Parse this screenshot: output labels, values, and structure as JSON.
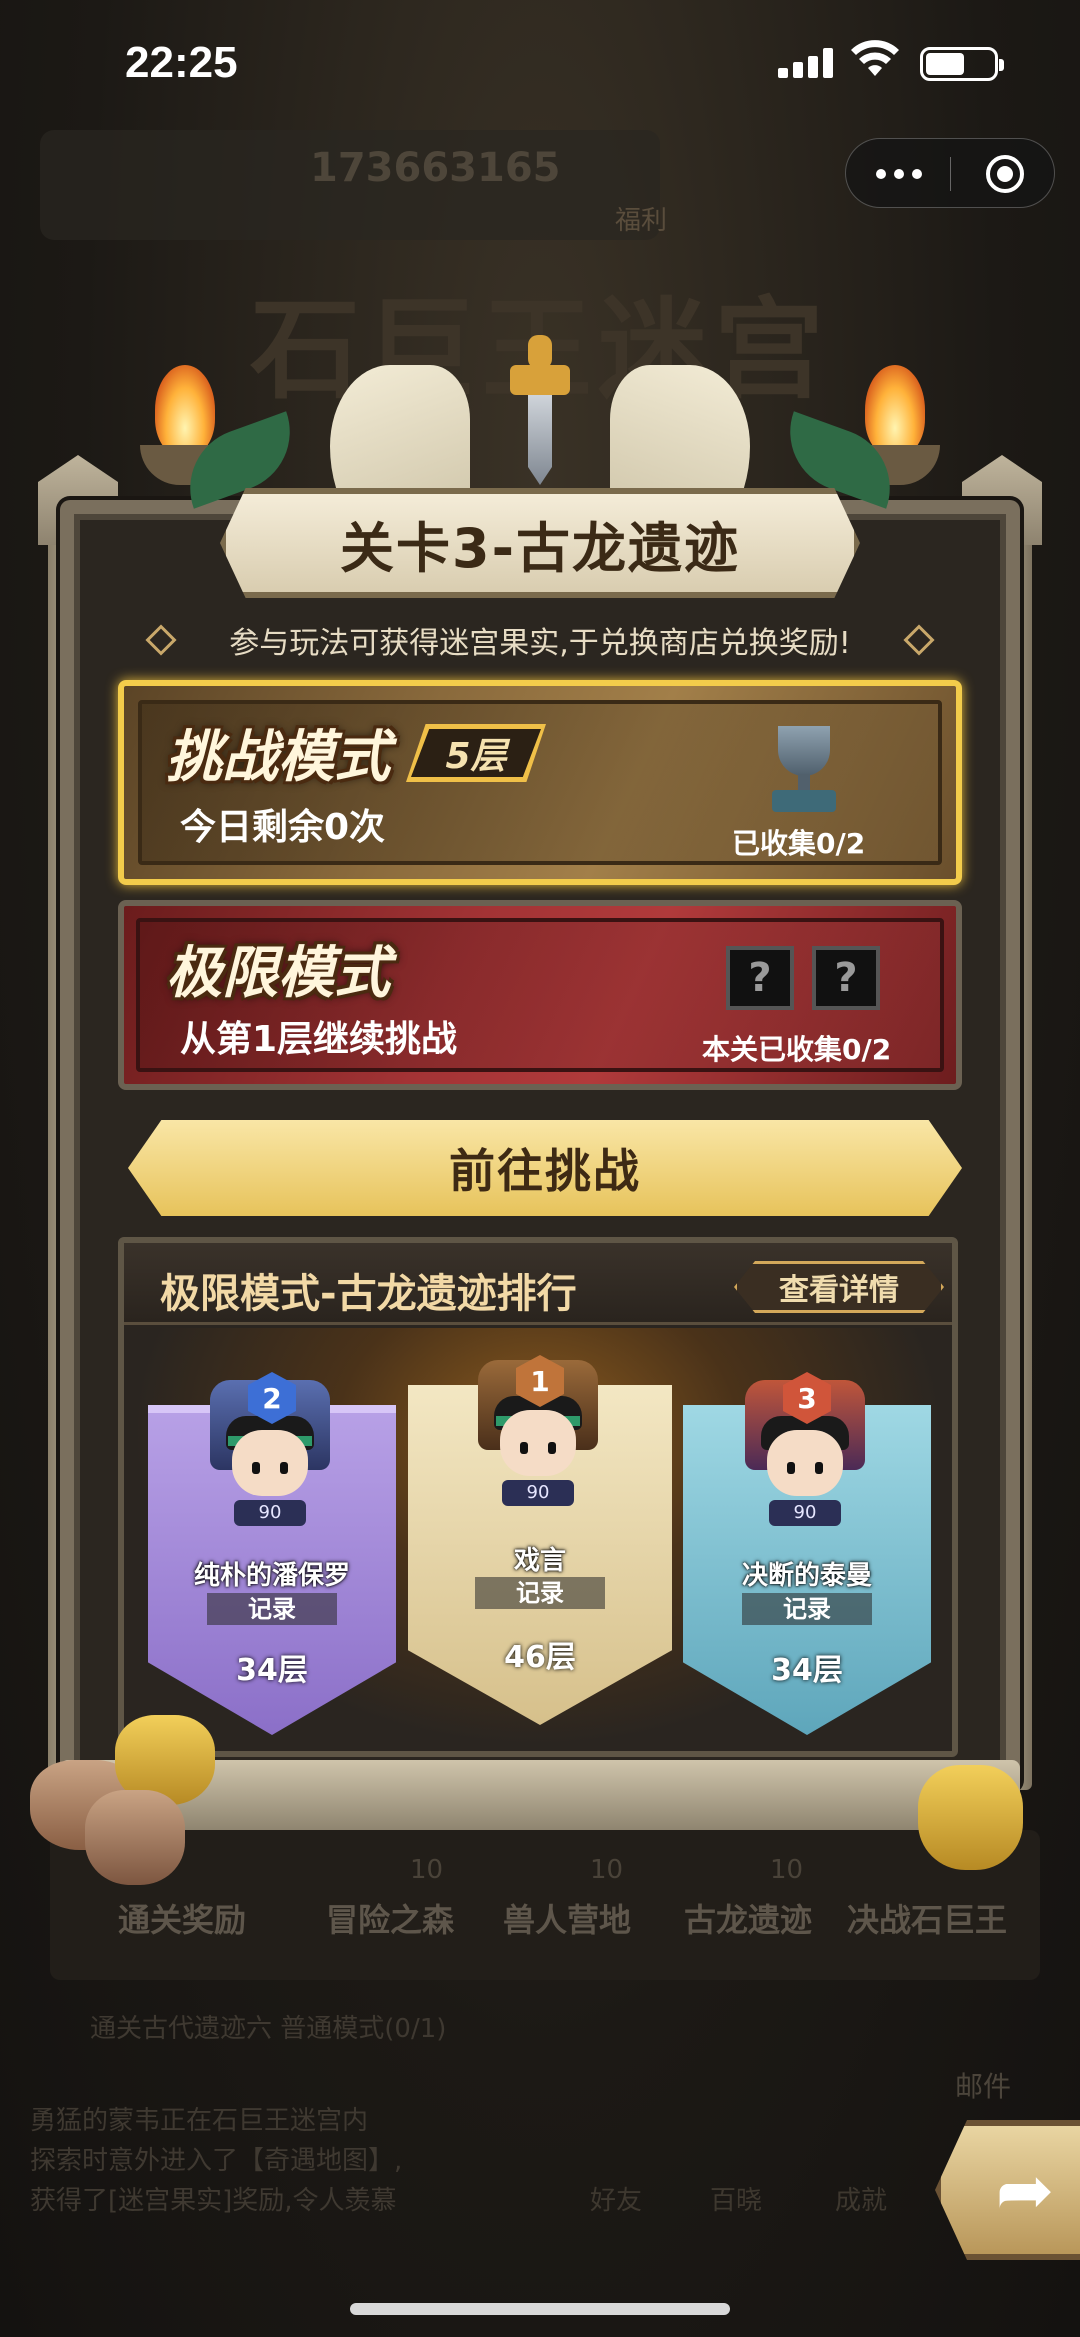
{
  "status_bar": {
    "time": "22:25"
  },
  "background": {
    "user_id": "173663165",
    "fuli_label": "福利",
    "game_title": "石巨王迷宫",
    "tabs": [
      {
        "label": "通关奖励",
        "count": ""
      },
      {
        "label": "冒险之森",
        "count": "10"
      },
      {
        "label": "兽人营地",
        "count": "10"
      },
      {
        "label": "古龙遗迹",
        "count": "10"
      },
      {
        "label": "决战石巨王",
        "count": ""
      }
    ],
    "bottom_line_1": "通关古代遗迹六 普通模式(0/1)",
    "bottom_line_2": "勇猛的蒙韦正在石巨王迷宫内",
    "bottom_line_3": "探索时意外进入了【奇遇地图】,",
    "bottom_line_4": "获得了[迷宫果实]奖励,令人羡慕",
    "mail_label": "邮件",
    "bottom_icons": [
      "好友",
      "百晓",
      "成就"
    ]
  },
  "modal": {
    "title": "关卡3-古龙遗迹",
    "tip": "参与玩法可获得迷宫果实,于兑换商店兑换奖励!",
    "challenge_mode": {
      "title": "挑战模式",
      "floor_tag": "5层",
      "remaining": "今日剩余0次",
      "collected": "已收集0/2"
    },
    "extreme_mode": {
      "title": "极限模式",
      "continue": "从第1层继续挑战",
      "collected": "本关已收集0/2",
      "unknown_items": [
        "?",
        "?"
      ]
    },
    "go_button": "前往挑战",
    "ranking": {
      "title": "极限模式-古龙遗迹排行",
      "details_button": "查看详情",
      "players": [
        {
          "rank": "2",
          "name": "纯朴的潘保罗",
          "level": "90",
          "record_label": "记录",
          "floor": "34层"
        },
        {
          "rank": "1",
          "name": "戏言",
          "level": "90",
          "record_label": "记录",
          "floor": "46层"
        },
        {
          "rank": "3",
          "name": "决断的泰曼",
          "level": "90",
          "record_label": "记录",
          "floor": "34层"
        }
      ]
    }
  },
  "icons": {
    "more": "more-dots-icon",
    "target": "target-icon",
    "share": "share-arrow-icon",
    "trophy": "trophy-icon"
  }
}
